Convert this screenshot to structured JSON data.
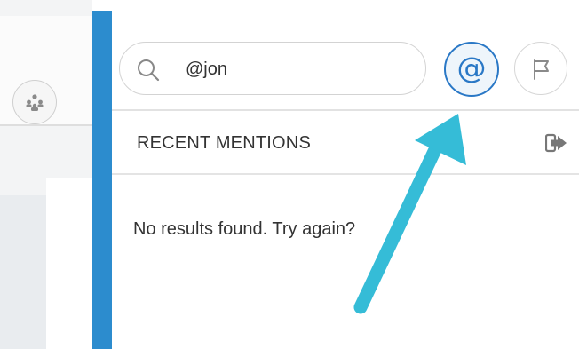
{
  "search": {
    "value": "@jon",
    "icon": "search-icon"
  },
  "buttons": {
    "mentions_glyph": "@",
    "flag_icon": "flag-icon",
    "team_icon": "team-icon"
  },
  "mentions": {
    "title": "RECENT MENTIONS",
    "exit_icon": "exit-icon"
  },
  "results": {
    "empty_text": "No results found. Try again?"
  },
  "colors": {
    "accent_blue": "#2a78c6",
    "divider_blue": "#2c8cce",
    "arrow_cyan": "#35bcd7"
  }
}
